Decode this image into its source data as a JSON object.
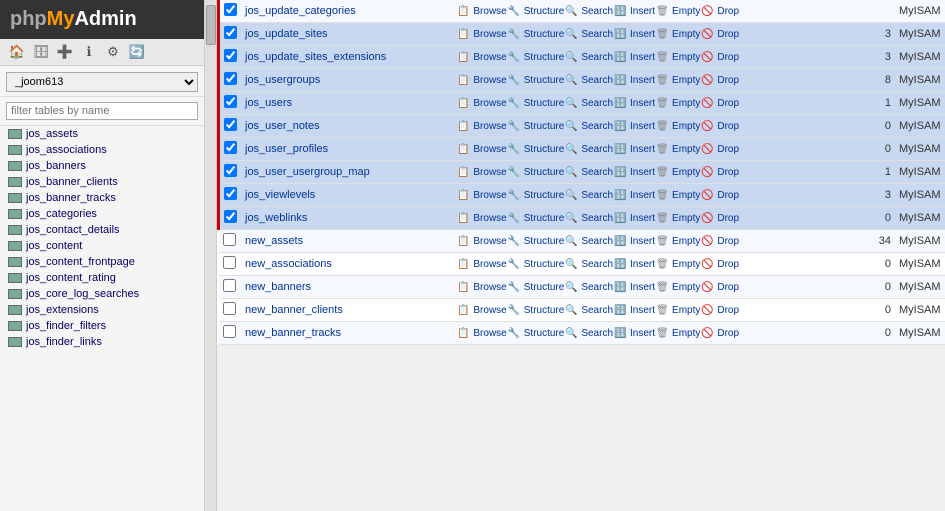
{
  "logo": {
    "php": "php",
    "my": "My",
    "admin": "Admin"
  },
  "sidebar": {
    "db_options": [
      "_joom613"
    ],
    "db_selected": "_joom613",
    "filter_placeholder": "filter tables by name",
    "tables": [
      "jos_assets",
      "jos_associations",
      "jos_banners",
      "jos_banner_clients",
      "jos_banner_tracks",
      "jos_categories",
      "jos_contact_details",
      "jos_content",
      "jos_content_frontpage",
      "jos_content_rating",
      "jos_core_log_searches",
      "jos_extensions",
      "jos_finder_filters",
      "jos_finder_links"
    ]
  },
  "main_table": {
    "rows": [
      {
        "checked": true,
        "name": "jos_update_categories",
        "count": "",
        "engine": "MyISAM",
        "highlighted": false
      },
      {
        "checked": true,
        "name": "jos_update_sites",
        "count": "3",
        "engine": "MyISAM",
        "highlighted": true
      },
      {
        "checked": true,
        "name": "jos_update_sites_extensions",
        "count": "3",
        "engine": "MyISAM",
        "highlighted": true
      },
      {
        "checked": true,
        "name": "jos_usergroups",
        "count": "8",
        "engine": "MyISAM",
        "highlighted": true
      },
      {
        "checked": true,
        "name": "jos_users",
        "count": "1",
        "engine": "MyISAM",
        "highlighted": true
      },
      {
        "checked": true,
        "name": "jos_user_notes",
        "count": "0",
        "engine": "MyISAM",
        "highlighted": true
      },
      {
        "checked": true,
        "name": "jos_user_profiles",
        "count": "0",
        "engine": "MyISAM",
        "highlighted": true
      },
      {
        "checked": true,
        "name": "jos_user_usergroup_map",
        "count": "1",
        "engine": "MyISAM",
        "highlighted": true
      },
      {
        "checked": true,
        "name": "jos_viewlevels",
        "count": "3",
        "engine": "MyISAM",
        "highlighted": true
      },
      {
        "checked": true,
        "name": "jos_weblinks",
        "count": "0",
        "engine": "MyISAM",
        "highlighted": true
      },
      {
        "checked": false,
        "name": "new_assets",
        "count": "34",
        "engine": "MyISAM",
        "highlighted": false
      },
      {
        "checked": false,
        "name": "new_associations",
        "count": "0",
        "engine": "MyISAM",
        "highlighted": false
      },
      {
        "checked": false,
        "name": "new_banners",
        "count": "0",
        "engine": "MyISAM",
        "highlighted": false
      },
      {
        "checked": false,
        "name": "new_banner_clients",
        "count": "0",
        "engine": "MyISAM",
        "highlighted": false
      },
      {
        "checked": false,
        "name": "new_banner_tracks",
        "count": "0",
        "engine": "MyISAM",
        "highlighted": false
      }
    ],
    "actions": [
      "Browse",
      "Structure",
      "Search",
      "Insert",
      "Empty",
      "Drop"
    ]
  }
}
